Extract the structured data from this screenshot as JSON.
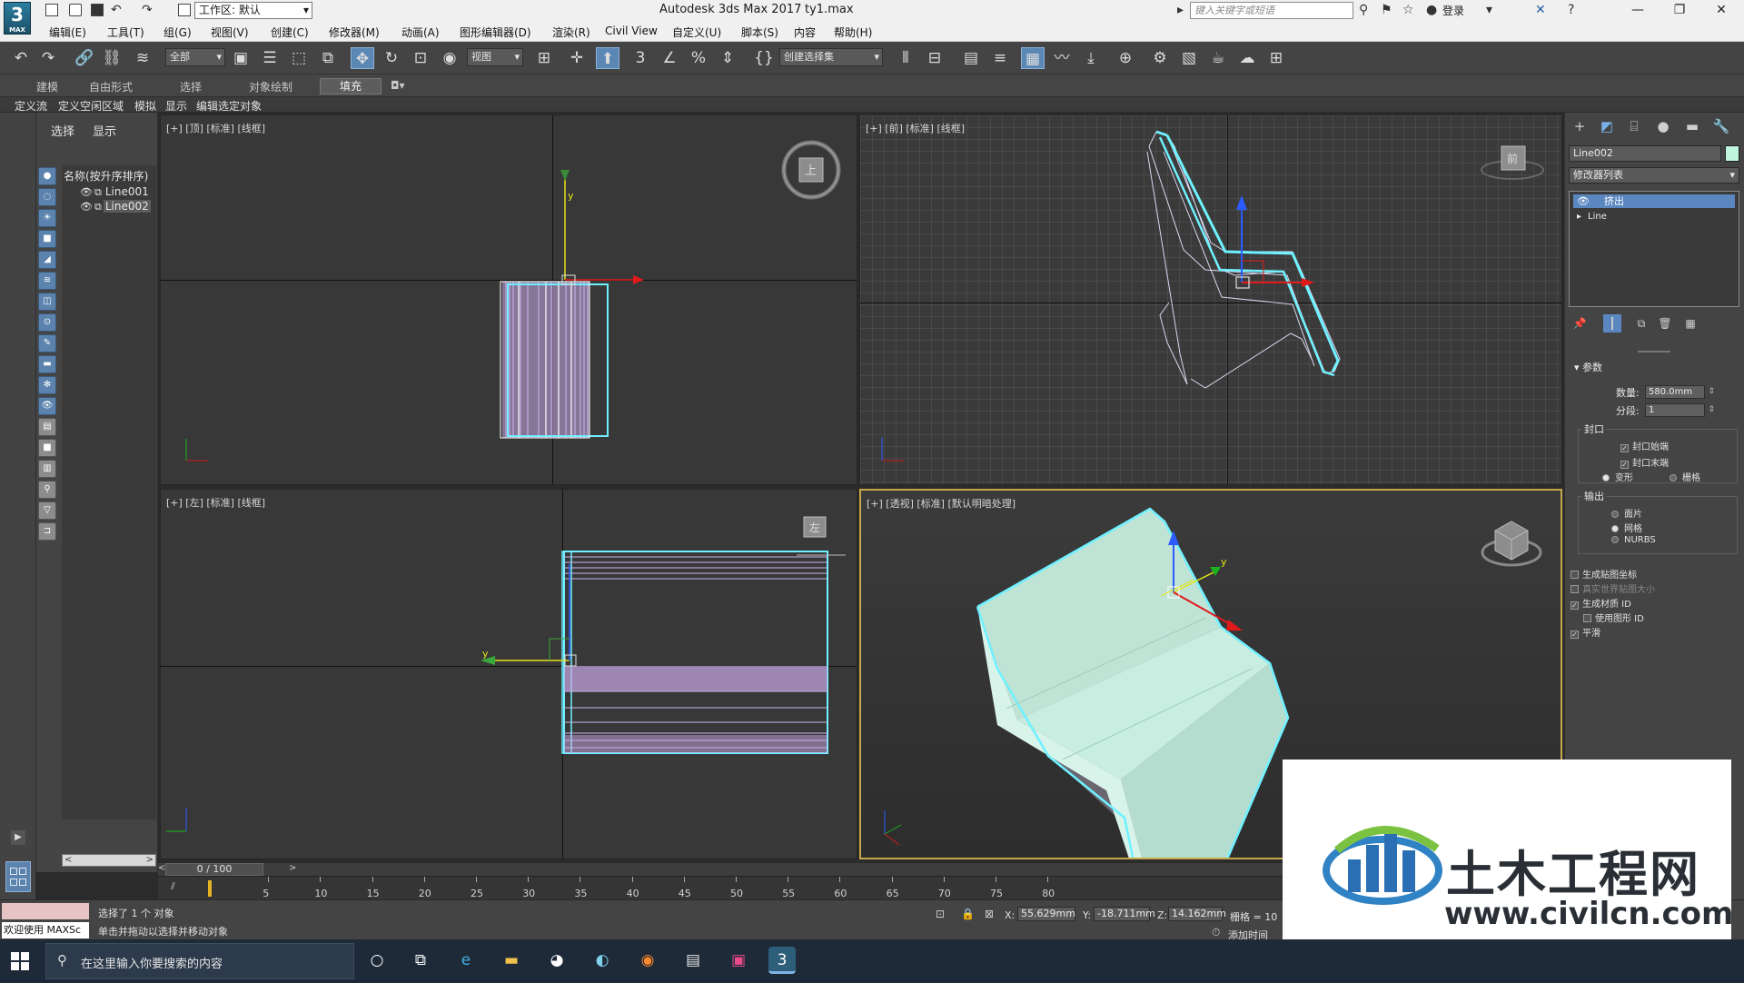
{
  "titlebar": {
    "logo_number": "3",
    "logo_sub": "MAX",
    "workspace": "工作区: 默认",
    "app_title": "Autodesk 3ds Max 2017",
    "file_name": "ty1.max",
    "search_placeholder": "键入关键字或短语",
    "login": "登录"
  },
  "menu": [
    "编辑(E)",
    "工具(T)",
    "组(G)",
    "视图(V)",
    "创建(C)",
    "修改器(M)",
    "动画(A)",
    "图形编辑器(D)",
    "渲染(R)",
    "Civil View",
    "自定义(U)",
    "脚本(S)",
    "内容",
    "帮助(H)"
  ],
  "toolbar": {
    "selection_filter": "全部",
    "ref_coord": "视图",
    "named_selection": "创建选择集"
  },
  "ribbon": {
    "tabs": [
      "建模",
      "自由形式",
      "选择",
      "对象绘制"
    ],
    "active_tab": "填充",
    "sub_tabs": [
      "定义流",
      "定义空闲区域",
      "模拟",
      "显示",
      "编辑选定对象"
    ]
  },
  "explorer": {
    "tabs": [
      "选择",
      "显示"
    ],
    "list_header": "名称(按升序排序)",
    "objects": [
      "Line001",
      "Line002"
    ],
    "selected": "Line002"
  },
  "viewports": {
    "top_left": "[+] [顶] [标准] [线框]",
    "top_right": "[+] [前] [标准] [线框]",
    "bottom_left": "[+] [左] [标准] [线框]",
    "bottom_right": "[+] [透视] [标准] [默认明暗处理]",
    "cube_top": "上",
    "cube_front": "前",
    "cube_left": "左"
  },
  "command_panel": {
    "object_name": "Line002",
    "object_color": "#bff5dc",
    "modifier_list": "修改器列表",
    "stack": [
      "挤出",
      "Line"
    ],
    "rollout": "参数",
    "amount_label": "数量:",
    "amount_value": "580.0mm",
    "segments_label": "分段:",
    "segments_value": "1",
    "capping_group": "封口",
    "cap_start": "封口始端",
    "cap_end": "封口末端",
    "morph": "变形",
    "grid": "栅格",
    "output_group": "输出",
    "out_patch": "面片",
    "out_mesh": "网格",
    "out_nurbs": "NURBS",
    "gen_mapping": "生成贴图坐标",
    "real_world": "真实世界贴图大小",
    "gen_matid": "生成材质 ID",
    "use_shape_id": "使用图形 ID",
    "smooth": "平滑"
  },
  "timeline": {
    "frame_display": "0 / 100",
    "ticks": [
      "5",
      "10",
      "15",
      "20",
      "25",
      "30",
      "35",
      "40",
      "45",
      "50",
      "55",
      "60",
      "65",
      "70",
      "75",
      "80"
    ]
  },
  "status": {
    "welcome": "欢迎使用 MAXSc",
    "selection": "选择了 1 个 对象",
    "hint": "单击并拖动以选择并移动对象",
    "x_label": "X:",
    "x_value": "55.629mm",
    "y_label": "Y:",
    "y_value": "-18.711mm",
    "z_label": "Z:",
    "z_value": "14.162mm",
    "grid": "栅格 = 10",
    "add_time_tag": "添加时间"
  },
  "watermark": {
    "cn": "土木工程网",
    "url": "www.civilcn.com"
  },
  "taskbar": {
    "search_placeholder": "在这里输入你要搜索的内容"
  }
}
